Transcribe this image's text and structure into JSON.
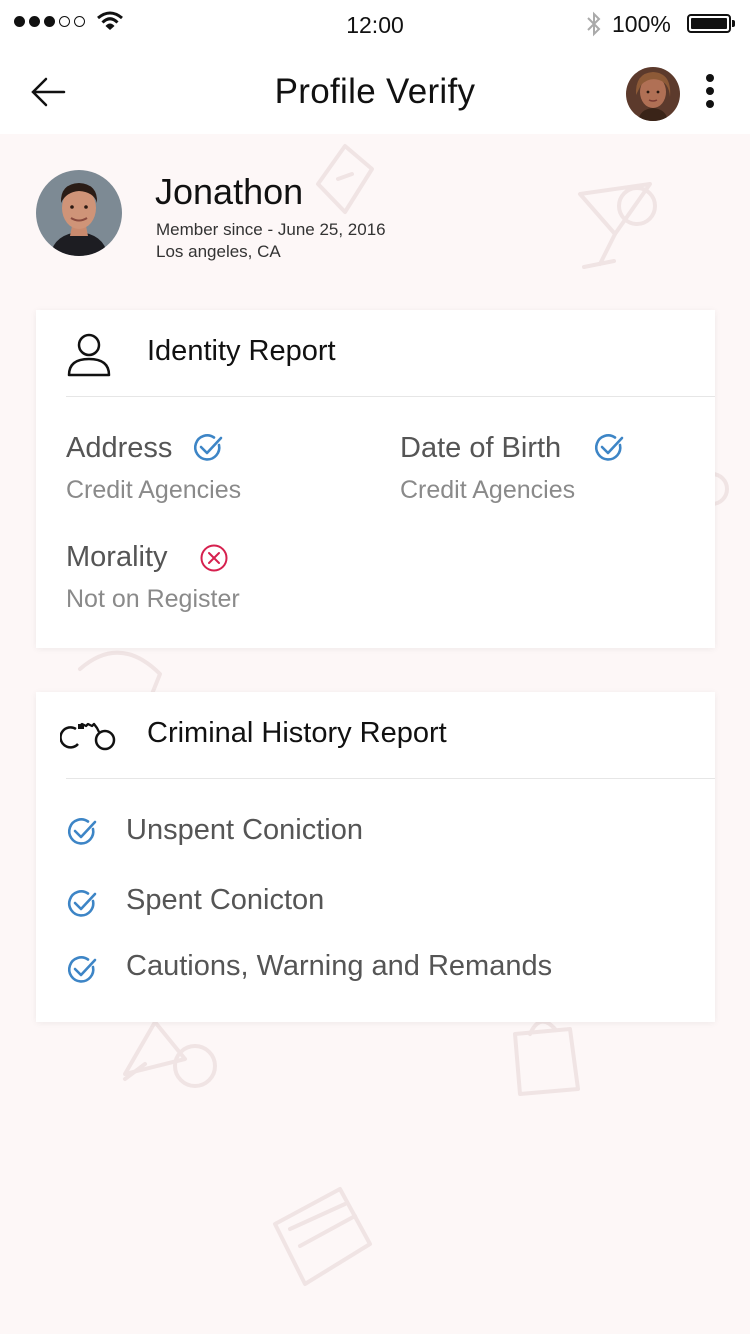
{
  "status_bar": {
    "time": "12:00",
    "battery": "100%"
  },
  "header": {
    "title": "Profile Verify"
  },
  "profile": {
    "name": "Jonathon",
    "member_since": "Member since - June 25, 2016",
    "location": "Los angeles, CA"
  },
  "identity_report": {
    "title": "Identity Report",
    "fields": [
      {
        "label": "Address",
        "source": "Credit Agencies",
        "status": "verified"
      },
      {
        "label": "Date of Birth",
        "source": "Credit Agencies",
        "status": "verified"
      },
      {
        "label": "Morality",
        "source": "Not on Register",
        "status": "failed"
      }
    ]
  },
  "criminal_report": {
    "title": "Criminal History Report",
    "items": [
      {
        "label": "Unspent Coniction",
        "status": "verified"
      },
      {
        "label": "Spent Conicton",
        "status": "verified"
      },
      {
        "label": "Cautions, Warning and Remands",
        "status": "verified"
      }
    ]
  },
  "colors": {
    "verified": "#3d85c6",
    "failed": "#d6204e",
    "background": "#fdf7f7"
  }
}
